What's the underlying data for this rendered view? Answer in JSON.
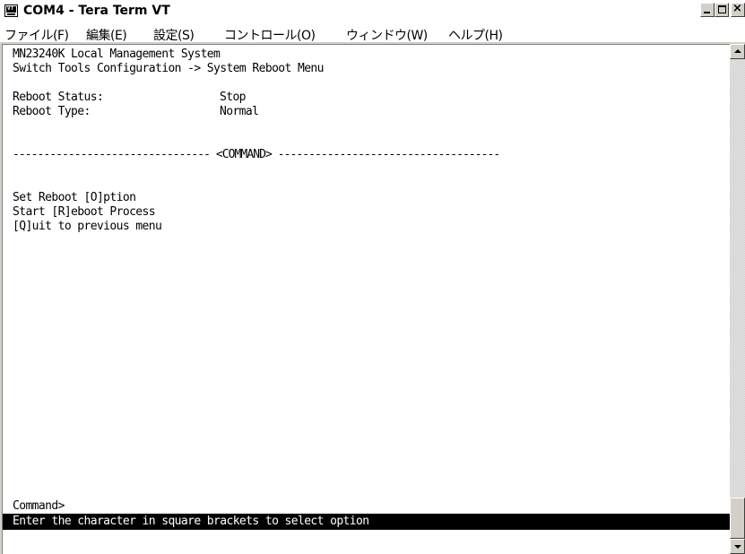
{
  "window": {
    "title": "COM4 - Tera Term VT",
    "app_icon": "tera-term-icon",
    "app_icon_text": "VT",
    "buttons": {
      "minimize": "minimize-icon",
      "maximize": "maximize-icon",
      "close": "close-icon"
    },
    "close_glyph": "×"
  },
  "menu": {
    "items": [
      {
        "label": "ファイル(F)"
      },
      {
        "label": "編集(E)"
      },
      {
        "label": "設定(S)"
      },
      {
        "label": "コントロール(O)"
      },
      {
        "label": "ウィンドウ(W)"
      },
      {
        "label": "ヘルプ(H)"
      }
    ]
  },
  "terminal": {
    "header_line1": "MN23240K Local Management System",
    "header_line2": "Switch Tools Configuration -> System Reboot Menu",
    "status_label": "Reboot Status:",
    "status_value": "Stop",
    "type_label": "Reboot Type:",
    "type_value": "Normal",
    "separator": "-------------------------------- <COMMAND> ------------------------------------",
    "options": [
      "Set Reboot [O]ption",
      "Start [R]eboot Process",
      "[Q]uit to previous menu"
    ],
    "prompt": "Command>",
    "help_text": "Enter the character in square brackets to select option"
  },
  "scrollbar": {
    "up_icon": "scroll-up-arrow-icon",
    "down_icon": "scroll-down-arrow-icon"
  }
}
